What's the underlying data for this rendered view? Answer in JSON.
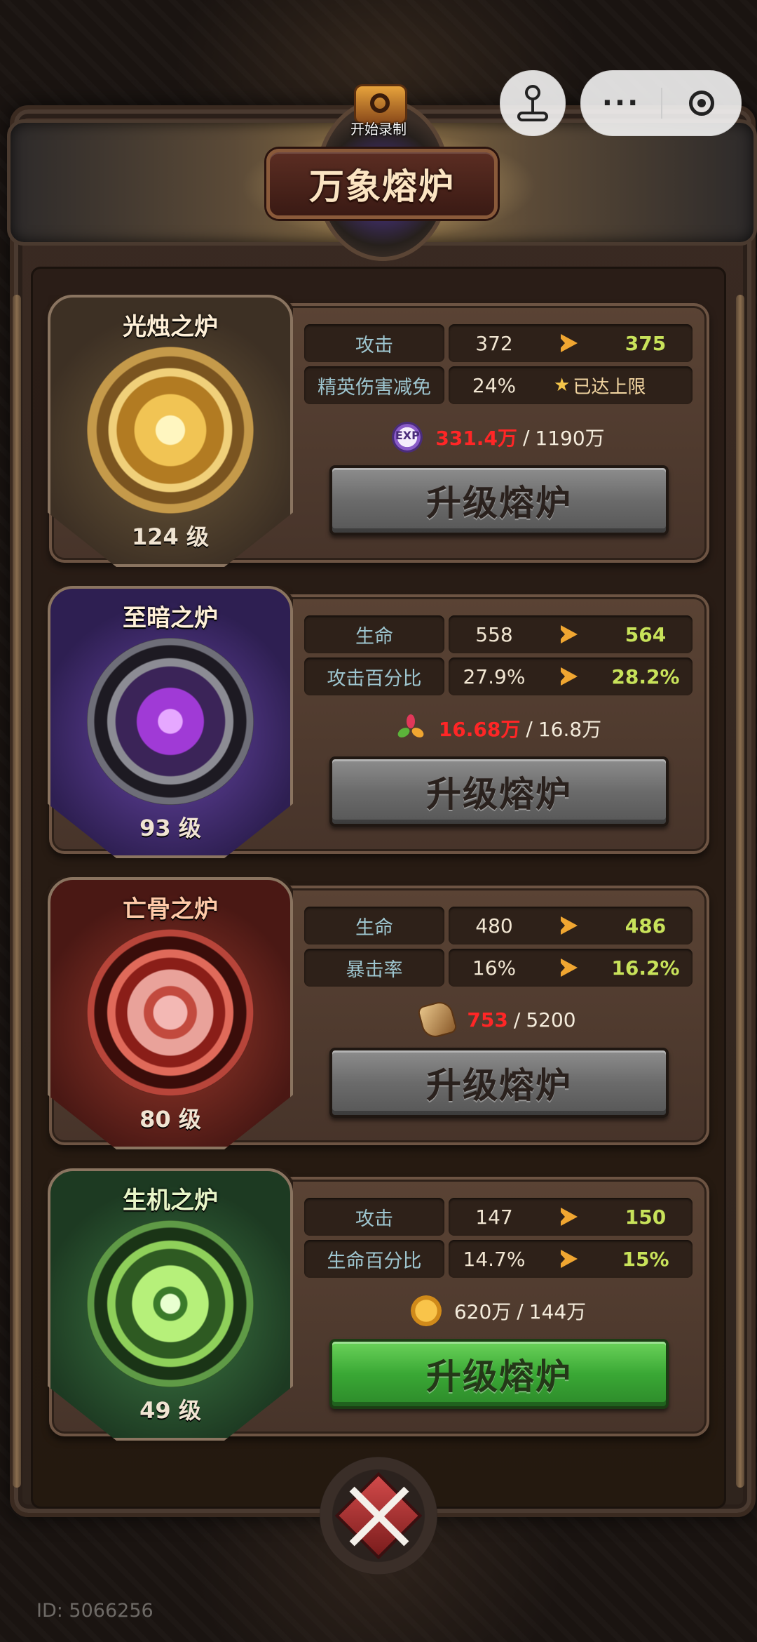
{
  "header": {
    "title": "万象熔炉",
    "record_label": "开始录制"
  },
  "mini_program_bar": {
    "more_glyph": "···"
  },
  "furnaces": [
    {
      "name": "光烛之炉",
      "level": "124 级",
      "theme_color": "#6e5a3a",
      "stats": [
        {
          "name": "攻击",
          "current": "372",
          "next": "375"
        },
        {
          "name": "精英伤害减免",
          "current": "24%",
          "cap_text": "已达上限"
        }
      ],
      "cost": {
        "icon": "exp-icon",
        "have": "331.4万",
        "need": "1190万"
      },
      "button_label": "升级熔炉",
      "button_state": "gray"
    },
    {
      "name": "至暗之炉",
      "level": "93 级",
      "theme_color": "#4a2f7a",
      "stats": [
        {
          "name": "生命",
          "current": "558",
          "next": "564"
        },
        {
          "name": "攻击百分比",
          "current": "27.9%",
          "next": "28.2%"
        }
      ],
      "cost": {
        "icon": "flower-icon",
        "have": "16.68万",
        "need": "16.8万"
      },
      "button_label": "升级熔炉",
      "button_state": "gray"
    },
    {
      "name": "亡骨之炉",
      "level": "80 级",
      "theme_color": "#7a2a24",
      "stats": [
        {
          "name": "生命",
          "current": "480",
          "next": "486"
        },
        {
          "name": "暴击率",
          "current": "16%",
          "next": "16.2%"
        }
      ],
      "cost": {
        "icon": "scroll-icon",
        "have": "753",
        "need": "5200"
      },
      "button_label": "升级熔炉",
      "button_state": "gray"
    },
    {
      "name": "生机之炉",
      "level": "49 级",
      "theme_color": "#2e5a32",
      "stats": [
        {
          "name": "攻击",
          "current": "147",
          "next": "150"
        },
        {
          "name": "生命百分比",
          "current": "14.7%",
          "next": "15%"
        }
      ],
      "cost": {
        "icon": "coin-icon",
        "have": "620万",
        "need": "144万"
      },
      "button_label": "升级熔炉",
      "button_state": "green"
    }
  ],
  "footer": {
    "user_id": "ID: 5066256"
  },
  "colors": {
    "stat_label": "#9ec6d0",
    "next_value": "#c8e25a",
    "insufficient": "#ff2626",
    "arrow": "#f0a631"
  }
}
